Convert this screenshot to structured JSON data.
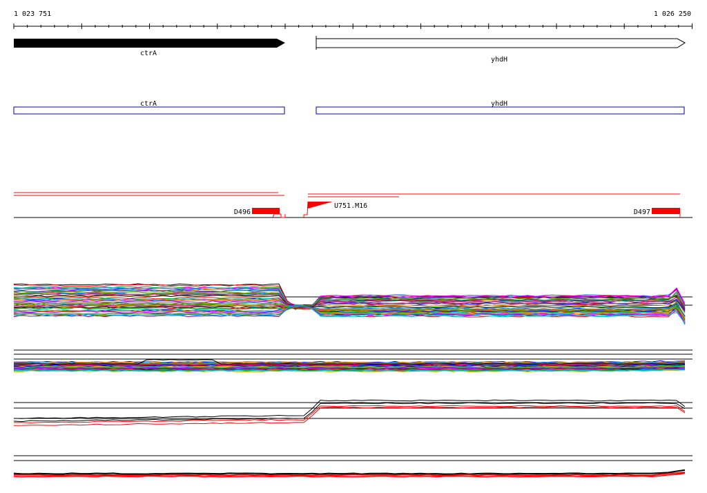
{
  "ruler": {
    "start_label": "1 023 751",
    "end_label": "1 026 250"
  },
  "genes": [
    {
      "name": "ctrA",
      "strand": "forward",
      "filled": true
    },
    {
      "name": "yhdH",
      "strand": "forward",
      "filled": false
    }
  ],
  "transcripts": [
    {
      "name": "ctrA"
    },
    {
      "name": "yhdH"
    }
  ],
  "features": [
    {
      "label": "D496",
      "color": "#ff0000"
    },
    {
      "label": "U751.M16",
      "color": "#ff0000"
    },
    {
      "label": "D497",
      "color": "#ff0000"
    }
  ],
  "colors": {
    "gene_fill": "#000000",
    "transcript_stroke": "#0000aa",
    "feature": "#ff0000",
    "axis": "#000000"
  },
  "profile_palette": [
    "#000000",
    "#ff0000",
    "#00aa00",
    "#0000ff",
    "#ff00ff",
    "#00cccc",
    "#ff8800",
    "#8800ff",
    "#888800",
    "#008888",
    "#aa0055",
    "#55aa00",
    "#0088ff",
    "#ff0088",
    "#666666",
    "#ccaa00"
  ]
}
